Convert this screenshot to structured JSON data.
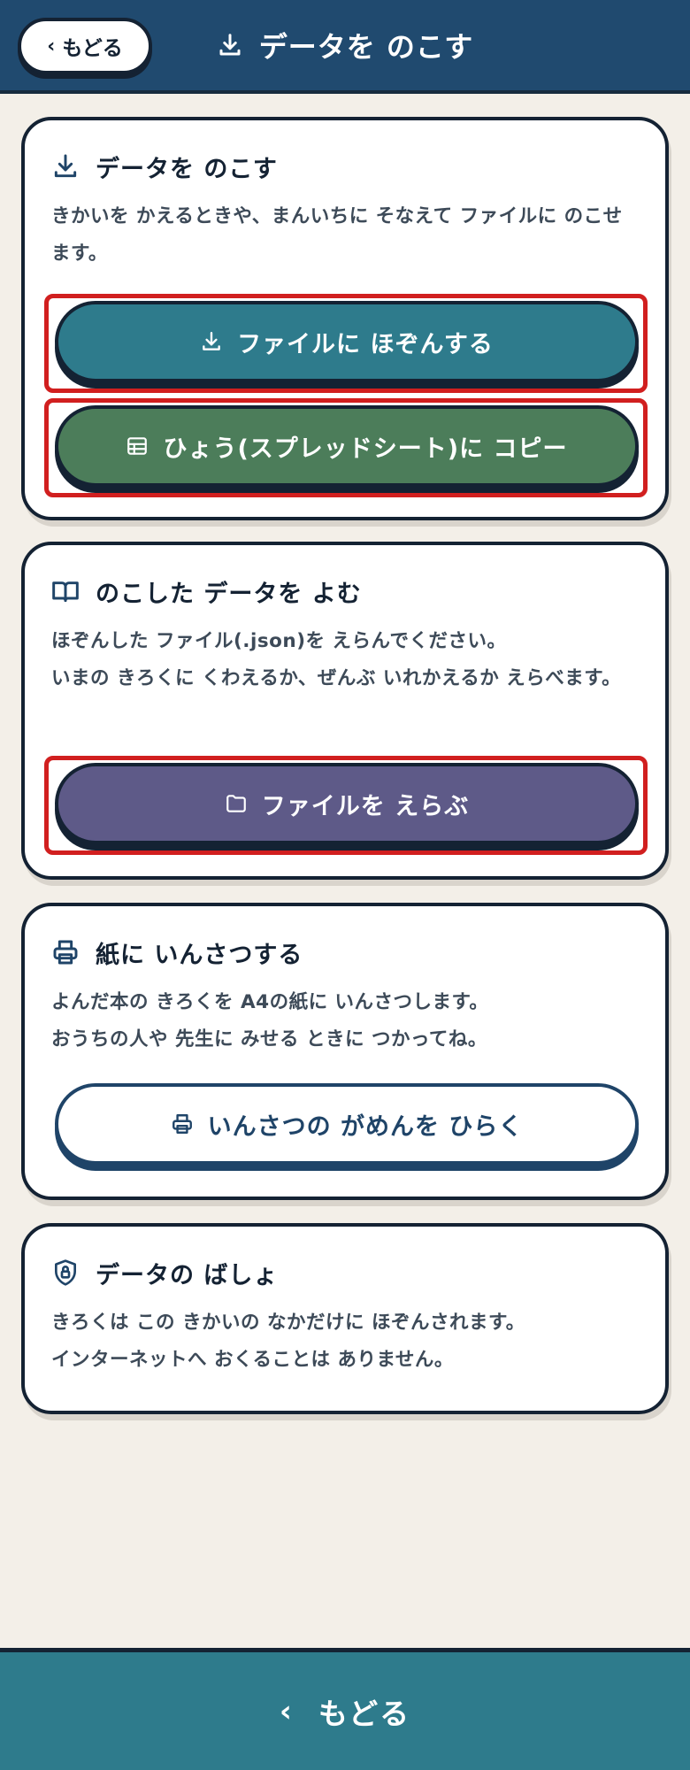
{
  "header": {
    "back_label": "もどる",
    "back_icon": "chevron-left-icon",
    "title": "データを のこす",
    "title_icon": "download-icon"
  },
  "cards": {
    "save": {
      "title": "データを のこす",
      "icon": "download-icon",
      "lines": [
        "きかいを かえるときや、まんいちに そなえて ファイルに のこせます。"
      ],
      "buttons": {
        "file_save": {
          "label": "ファイルに ほぞんする",
          "icon": "download-icon"
        },
        "sheet_copy": {
          "label": "ひょう(スプレッドシート)に コピー",
          "icon": "table-icon"
        }
      }
    },
    "load": {
      "title": "のこした データを よむ",
      "icon": "book-icon",
      "lines": [
        "ほぞんした ファイル(.json)を えらんでください。",
        "いまの きろくに くわえるか、ぜんぶ いれかえるか えらべます。"
      ],
      "buttons": {
        "choose_file": {
          "label": "ファイルを えらぶ",
          "icon": "folder-icon"
        }
      }
    },
    "print": {
      "title": "紙に いんさつする",
      "icon": "printer-icon",
      "lines": [
        "よんだ本の きろくを A4の紙に いんさつします。",
        "おうちの人や 先生に みせる ときに つかってね。"
      ],
      "buttons": {
        "open_print": {
          "label": "いんさつの がめんを ひらく",
          "icon": "printer-icon"
        }
      }
    },
    "storage": {
      "title": "データの ばしょ",
      "icon": "shield-lock-icon",
      "lines": [
        "きろくは この きかいの なかだけに ほぞんされます。",
        "インターネットへ おくることは ありません。"
      ]
    }
  },
  "footer": {
    "back_label": "もどる",
    "back_icon": "chevron-left-icon"
  },
  "colors": {
    "header_bg": "#204a6f",
    "page_bg": "#f3efe8",
    "teal": "#2e7b8c",
    "green": "#4c7d5a",
    "purple": "#5e5a88",
    "highlight": "#d11f1f"
  }
}
